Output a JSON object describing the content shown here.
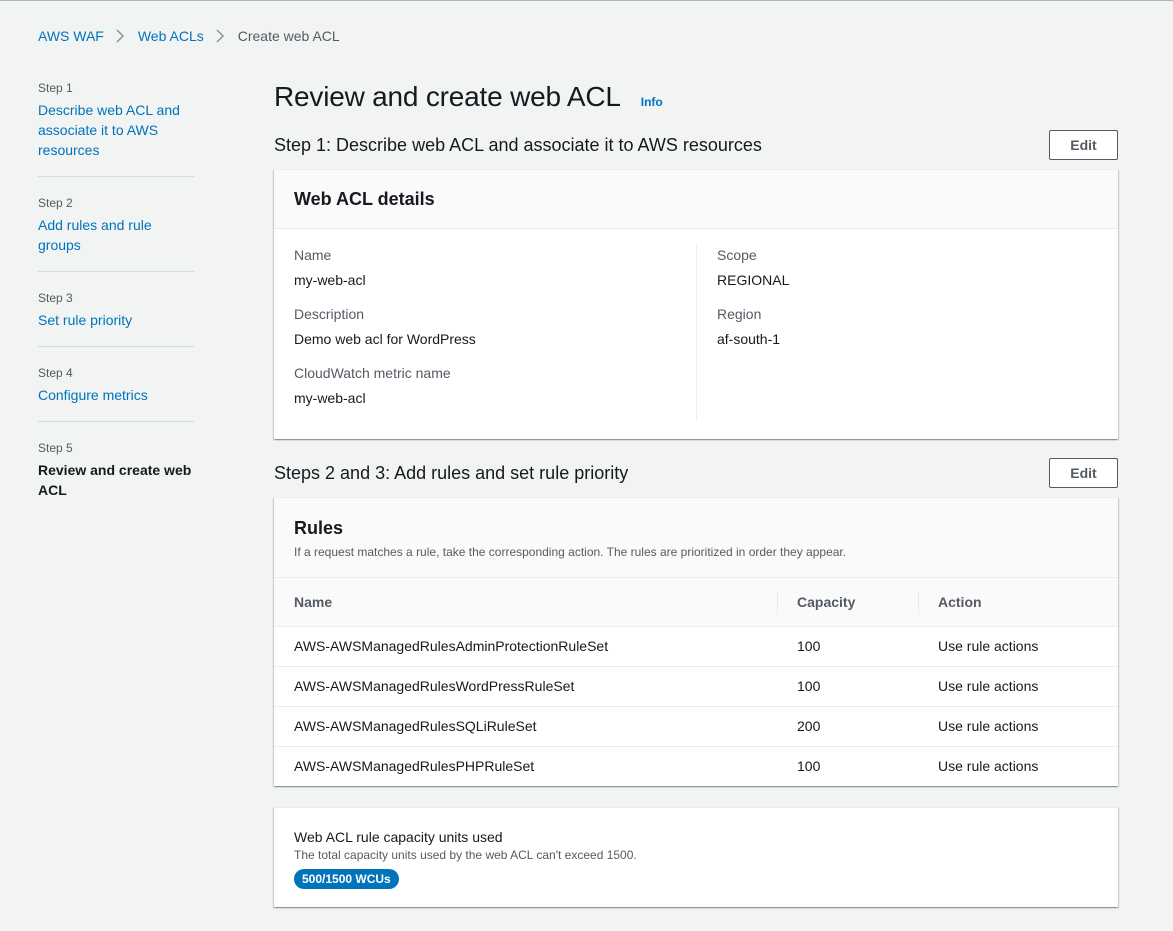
{
  "breadcrumb": {
    "items": [
      "AWS WAF",
      "Web ACLs"
    ],
    "current": "Create web ACL"
  },
  "wizard": {
    "steps": [
      {
        "num": "Step 1",
        "title": "Describe web ACL and associate it to AWS resources"
      },
      {
        "num": "Step 2",
        "title": "Add rules and rule groups"
      },
      {
        "num": "Step 3",
        "title": "Set rule priority"
      },
      {
        "num": "Step 4",
        "title": "Configure metrics"
      },
      {
        "num": "Step 5",
        "title": "Review and create web ACL"
      }
    ]
  },
  "page": {
    "title": "Review and create web ACL",
    "info": "Info"
  },
  "step1": {
    "title": "Step 1: Describe web ACL and associate it to AWS resources",
    "edit_label": "Edit",
    "panel_title": "Web ACL details",
    "fields": {
      "name_label": "Name",
      "name_value": "my-web-acl",
      "description_label": "Description",
      "description_value": "Demo web acl for WordPress",
      "metric_label": "CloudWatch metric name",
      "metric_value": "my-web-acl",
      "scope_label": "Scope",
      "scope_value": "REGIONAL",
      "region_label": "Region",
      "region_value": "af-south-1"
    }
  },
  "step23": {
    "title": "Steps 2 and 3: Add rules and set rule priority",
    "edit_label": "Edit",
    "panel_title": "Rules",
    "panel_description": "If a request matches a rule, take the corresponding action. The rules are prioritized in order they appear.",
    "columns": [
      "Name",
      "Capacity",
      "Action"
    ],
    "rows": [
      [
        "AWS-AWSManagedRulesAdminProtectionRuleSet",
        "100",
        "Use rule actions"
      ],
      [
        "AWS-AWSManagedRulesWordPressRuleSet",
        "100",
        "Use rule actions"
      ],
      [
        "AWS-AWSManagedRulesSQLiRuleSet",
        "200",
        "Use rule actions"
      ],
      [
        "AWS-AWSManagedRulesPHPRuleSet",
        "100",
        "Use rule actions"
      ]
    ]
  },
  "capacity": {
    "title": "Web ACL rule capacity units used",
    "description": "The total capacity units used by the web ACL can't exceed 1500.",
    "badge": "500/1500 WCUs"
  },
  "colors": {
    "link": "#0073bb",
    "background": "#f2f3f3",
    "badge": "#0073bb"
  },
  "icons": [
    "chevron-right-icon"
  ]
}
